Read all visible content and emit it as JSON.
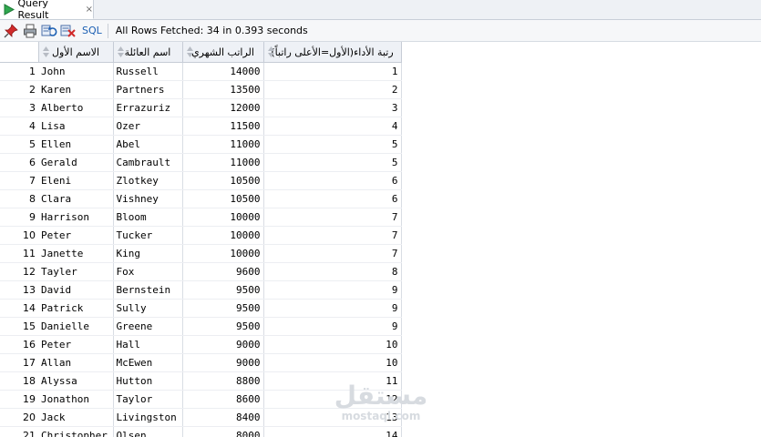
{
  "tab": {
    "title": "Query Result",
    "close_glyph": "×",
    "icon": "play-triangle-icon"
  },
  "toolbar": {
    "icons": [
      "pin-icon",
      "print-icon",
      "refresh-icon",
      "clear-icon"
    ],
    "sql_label": "SQL",
    "status": "All Rows Fetched: 34 in 0.393 seconds"
  },
  "grid": {
    "columns": [
      "الاسم الأول",
      "اسم العائلة",
      "الراتب الشهري",
      "رتبة الأداء(الأول=الأعلى راتباً)"
    ],
    "rows": [
      [
        "1",
        "John",
        "Russell",
        "14000",
        "1"
      ],
      [
        "2",
        "Karen",
        "Partners",
        "13500",
        "2"
      ],
      [
        "3",
        "Alberto",
        "Errazuriz",
        "12000",
        "3"
      ],
      [
        "4",
        "Lisa",
        "Ozer",
        "11500",
        "4"
      ],
      [
        "5",
        "Ellen",
        "Abel",
        "11000",
        "5"
      ],
      [
        "6",
        "Gerald",
        "Cambrault",
        "11000",
        "5"
      ],
      [
        "7",
        "Eleni",
        "Zlotkey",
        "10500",
        "6"
      ],
      [
        "8",
        "Clara",
        "Vishney",
        "10500",
        "6"
      ],
      [
        "9",
        "Harrison",
        "Bloom",
        "10000",
        "7"
      ],
      [
        "10",
        "Peter",
        "Tucker",
        "10000",
        "7"
      ],
      [
        "11",
        "Janette",
        "King",
        "10000",
        "7"
      ],
      [
        "12",
        "Tayler",
        "Fox",
        "9600",
        "8"
      ],
      [
        "13",
        "David",
        "Bernstein",
        "9500",
        "9"
      ],
      [
        "14",
        "Patrick",
        "Sully",
        "9500",
        "9"
      ],
      [
        "15",
        "Danielle",
        "Greene",
        "9500",
        "9"
      ],
      [
        "16",
        "Peter",
        "Hall",
        "9000",
        "10"
      ],
      [
        "17",
        "Allan",
        "McEwen",
        "9000",
        "10"
      ],
      [
        "18",
        "Alyssa",
        "Hutton",
        "8800",
        "11"
      ],
      [
        "19",
        "Jonathon",
        "Taylor",
        "8600",
        "12"
      ],
      [
        "20",
        "Jack",
        "Livingston",
        "8400",
        "13"
      ],
      [
        "21",
        "Christopher",
        "Olsen",
        "8000",
        "14"
      ]
    ]
  },
  "watermark": {
    "arabic": "مستقل",
    "latin": "mostaql.com"
  },
  "colors": {
    "accent": "#1b5fb3",
    "play": "#2fa84f",
    "header_bg": "#eef1f6"
  }
}
